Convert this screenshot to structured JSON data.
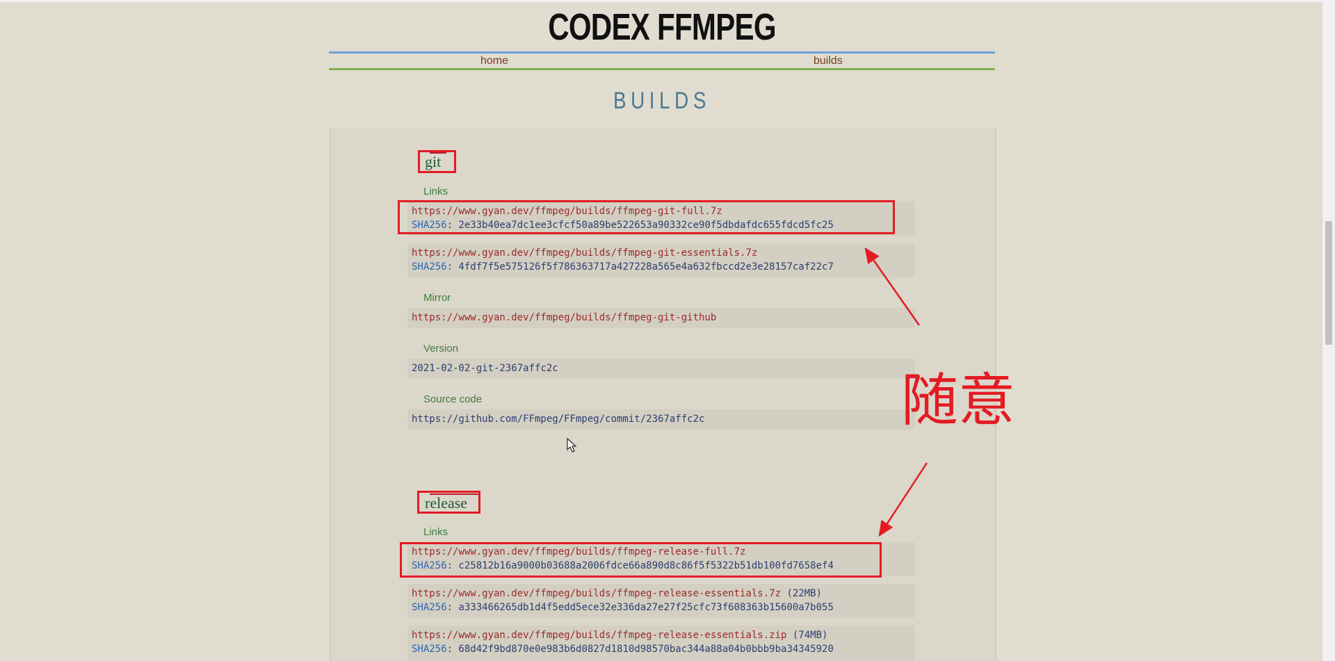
{
  "header": {
    "title": "CODEX FFMPEG",
    "nav": {
      "home": "home",
      "builds": "builds"
    }
  },
  "page_title": "BUILDS",
  "git": {
    "title": "git",
    "links_label": "Links",
    "full": {
      "url": "https://www.gyan.dev/ffmpeg/builds/ffmpeg-git-full.7z",
      "sha_label": "SHA256",
      "sha": ": 2e33b40ea7dc1ee3cfcf50a89be522653a90332ce90f5dbdafdc655fdcd5fc25"
    },
    "essentials": {
      "url": "https://www.gyan.dev/ffmpeg/builds/ffmpeg-git-essentials.7z",
      "sha_label": "SHA256",
      "sha": ": 4fdf7f5e575126f5f786363717a427228a565e4a632fbccd2e3e28157caf22c7"
    },
    "mirror_label": "Mirror",
    "mirror_url": "https://www.gyan.dev/ffmpeg/builds/ffmpeg-git-github",
    "version_label": "Version",
    "version": "2021-02-02-git-2367affc2c",
    "source_label": "Source code",
    "source_url": "https://github.com/FFmpeg/FFmpeg/commit/2367affc2c"
  },
  "release": {
    "title": "release",
    "links_label": "Links",
    "full": {
      "url": "https://www.gyan.dev/ffmpeg/builds/ffmpeg-release-full.7z",
      "sha_label": "SHA256",
      "sha": ": c25812b16a9000b03688a2006fdce66a890d8c86f5f5322b51db100fd7658ef4"
    },
    "essentials_7z": {
      "url": "https://www.gyan.dev/ffmpeg/builds/ffmpeg-release-essentials.7z",
      "size": " (22MB)",
      "sha_label": "SHA256",
      "sha": ": a333466265db1d4f5edd5ece32e336da27e27f25cfc73f608363b15600a7b055"
    },
    "essentials_zip": {
      "url": "https://www.gyan.dev/ffmpeg/builds/ffmpeg-release-essentials.zip",
      "size": " (74MB)",
      "sha_label": "SHA256",
      "sha": ": 68d42f9bd870e0e983b6d0827d1810d98570bac344a88a04b0bbb9ba34345920"
    }
  },
  "annotation": {
    "text": "随意",
    "color": "#e31b23"
  }
}
